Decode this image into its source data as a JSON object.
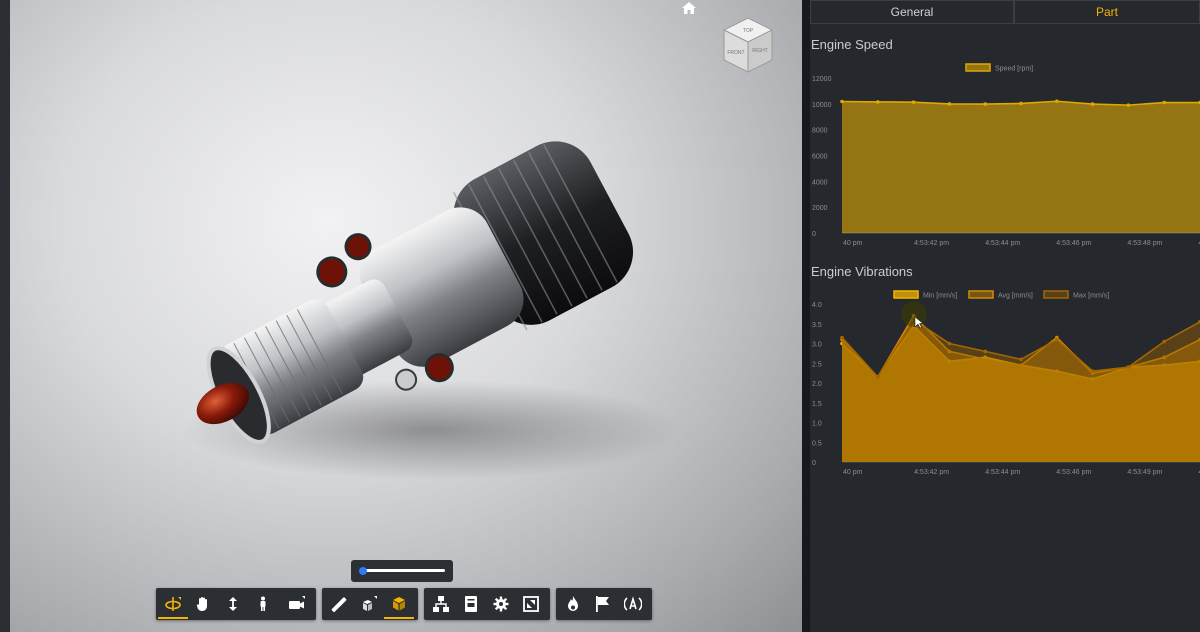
{
  "tabs": {
    "general": "General",
    "part": "Part"
  },
  "charts": {
    "speed": {
      "title": "Engine Speed"
    },
    "vibrations": {
      "title": "Engine Vibrations"
    }
  },
  "viewcube": {
    "top": "TOP",
    "front": "FRONT",
    "right": "RIGHT"
  },
  "toolbar": {
    "groups": [
      [
        "orbit-icon",
        "pan-icon",
        "dolly-icon",
        "first-person-icon",
        "camera-icon"
      ],
      [
        "measure-icon",
        "explode-icon",
        "model-browser-icon"
      ],
      [
        "structure-icon",
        "properties-icon",
        "settings-icon",
        "fullscreen-icon"
      ],
      [
        "fire-icon",
        "flag-icon",
        "broadcast-icon"
      ]
    ],
    "active": [
      "orbit-icon",
      "model-browser-icon"
    ]
  },
  "colors": {
    "accent": "#f3b400",
    "panel": "#25282c",
    "min": "#f3b400",
    "avg": "#d48a00",
    "max": "#9a5a00"
  },
  "chart_data": [
    {
      "type": "area",
      "title": "Engine Speed",
      "series": [
        {
          "name": "Speed [rpm]",
          "values": [
            10180,
            10150,
            10130,
            9990,
            9980,
            10030,
            10200,
            9980,
            9900,
            10100,
            10100
          ]
        }
      ],
      "x": [
        0,
        1,
        2,
        3,
        4,
        5,
        6,
        7,
        8,
        9,
        10
      ],
      "xtick_labels": [
        "40 pm",
        "4:53:42 pm",
        "4:53:44 pm",
        "4:53:46 pm",
        "4:53:48 pm",
        "4:53:"
      ],
      "ylim": [
        0,
        12000
      ],
      "yticks": [
        0,
        2000,
        4000,
        6000,
        8000,
        10000,
        12000
      ],
      "legend": "top-center",
      "grid": false
    },
    {
      "type": "area",
      "title": "Engine Vibrations",
      "x": [
        0,
        1,
        2,
        3,
        4,
        5,
        6,
        7,
        8,
        9,
        10
      ],
      "series": [
        {
          "name": "Min [mm/s]",
          "values": [
            3.0,
            2.15,
            3.45,
            2.55,
            2.65,
            2.45,
            2.3,
            2.1,
            2.4,
            2.45,
            2.55
          ]
        },
        {
          "name": "Avg [mm/s]",
          "values": [
            3.1,
            2.15,
            3.7,
            2.8,
            2.6,
            2.45,
            3.15,
            2.25,
            2.4,
            2.65,
            3.1
          ]
        },
        {
          "name": "Max [mm/s]",
          "values": [
            3.15,
            2.15,
            3.6,
            3.0,
            2.8,
            2.6,
            3.1,
            2.3,
            2.4,
            3.05,
            3.55
          ]
        }
      ],
      "xtick_labels": [
        "40 pm",
        "4:53:42 pm",
        "4:53:44 pm",
        "4:53:46 pm",
        "4:53:49 pm",
        "4:53:"
      ],
      "ylim": [
        0,
        4.0
      ],
      "yticks": [
        0,
        0.5,
        1.0,
        1.5,
        2.0,
        2.5,
        3.0,
        3.5,
        4.0
      ],
      "legend": "top-center",
      "grid": false
    }
  ]
}
